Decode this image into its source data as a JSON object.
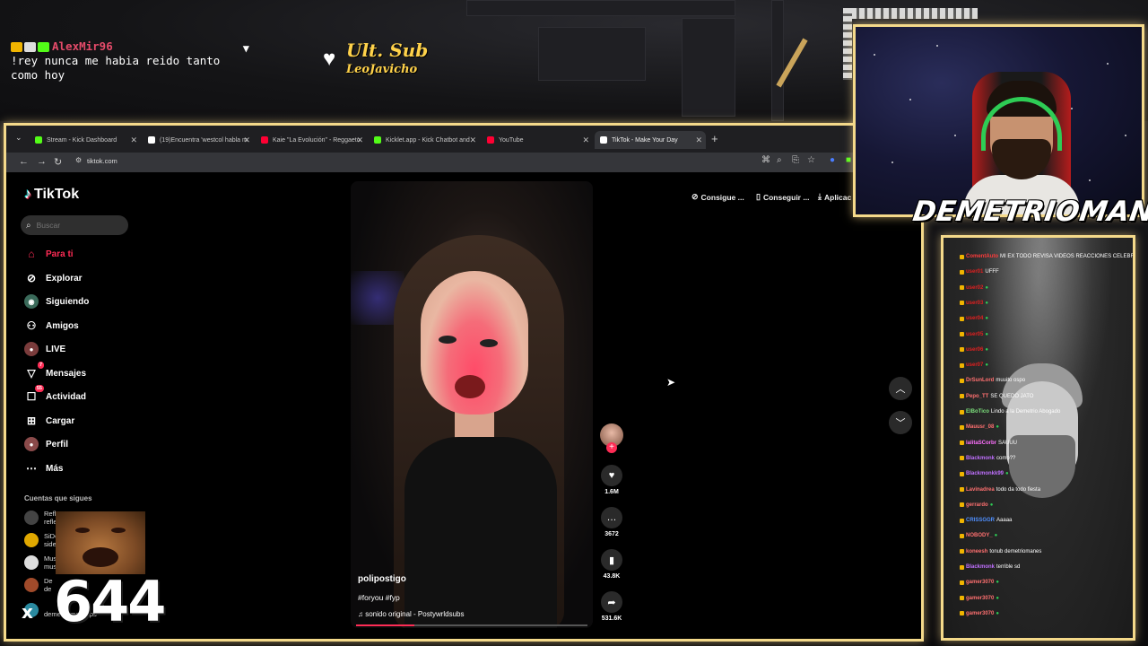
{
  "top_chat": {
    "username": "AlexMir96",
    "message": "!rey nunca me habia reido tanto como hoy"
  },
  "ult_sub": {
    "label": "Ult. Sub",
    "name": "LeoJavicho"
  },
  "browser": {
    "tabs": [
      {
        "label": "Stream - Kick Dashboard",
        "color": "#53fc18"
      },
      {
        "label": "(19)Encuentra 'westcol habla m",
        "color": "#ffffff"
      },
      {
        "label": "Kaie \"La Evolución\" - Reggaeto",
        "color": "#ff0033"
      },
      {
        "label": "Kicklet.app - Kick Chatbot and",
        "color": "#53fc18"
      },
      {
        "label": "YouTube",
        "color": "#ff0033"
      },
      {
        "label": "TikTok - Make Your Day",
        "color": "#ffffff"
      }
    ],
    "url": "tiktok.com"
  },
  "tiktok": {
    "logo": "TikTok",
    "search_placeholder": "Buscar",
    "nav": [
      {
        "label": "Para ti",
        "icon": "home-icon",
        "active": true
      },
      {
        "label": "Explorar",
        "icon": "compass-icon"
      },
      {
        "label": "Siguiendo",
        "icon": "following-icon"
      },
      {
        "label": "Amigos",
        "icon": "friends-icon"
      },
      {
        "label": "LIVE",
        "icon": "live-icon"
      },
      {
        "label": "Mensajes",
        "icon": "messages-icon",
        "badge": "7"
      },
      {
        "label": "Actividad",
        "icon": "activity-icon",
        "badge": "55"
      },
      {
        "label": "Cargar",
        "icon": "upload-icon"
      },
      {
        "label": "Perfil",
        "icon": "profile-icon"
      },
      {
        "label": "Más",
        "icon": "more-icon"
      }
    ],
    "following_title": "Cuentas que sigues",
    "following": [
      {
        "line1": "Refl",
        "line2": "refle"
      },
      {
        "line1": "SiDe",
        "line2": "side"
      },
      {
        "line1": "Mus",
        "line2": "mus"
      },
      {
        "line1": "De",
        "line2": "de"
      },
      {
        "line1": "Cli...",
        "line2": "demetriomanclips"
      }
    ],
    "top_actions": [
      "Consigue ...",
      "Conseguir ...",
      "Aplicac"
    ],
    "video": {
      "username": "polipostigo",
      "tags": "#foryou #fyp",
      "sound": "sonido original - Postywrldsubs",
      "progress": 0.25
    },
    "counts": {
      "likes": "1.6M",
      "comments": "3672",
      "saves": "43.8K",
      "shares": "531.6K"
    }
  },
  "overlay": {
    "combo_x": "x",
    "combo_count": "644",
    "streamer_name": "DEMETRIOMAN..."
  },
  "chat_overlay": {
    "lines": [
      {
        "user": "ComentAuto",
        "msg": "MI EX TODO REVISA VIDEOS REACCIONES CELEBRANDO O LA MANDARON NUEVOS VIDEOS PS",
        "color": "#ff3b3b"
      },
      {
        "user": "user01",
        "msg": "UFFF",
        "color": "#e02020"
      },
      {
        "user": "user02",
        "msg": "",
        "color": "#e02020"
      },
      {
        "user": "user03",
        "msg": "",
        "color": "#e02020"
      },
      {
        "user": "user04",
        "msg": "",
        "color": "#e02020"
      },
      {
        "user": "user05",
        "msg": "",
        "color": "#e02020"
      },
      {
        "user": "user06",
        "msg": "",
        "color": "#e02020"
      },
      {
        "user": "user07",
        "msg": "",
        "color": "#e02020"
      },
      {
        "user": "DrSunLord",
        "msg": "muuito ospo",
        "color": "#ff7070"
      },
      {
        "user": "Pepo_TT",
        "msg": "SE QUEDO JATO",
        "color": "#ff7070"
      },
      {
        "user": "ElBoTico",
        "msg": "Lindo a la Demetrio Abogado",
        "color": "#7ce07c"
      },
      {
        "user": "Mauusr_08",
        "msg": "",
        "color": "#ff7070"
      },
      {
        "user": "lalitaSCorbr",
        "msg": "SAUUU",
        "color": "#ff70ff"
      },
      {
        "user": "Blackmonk",
        "msg": "como??",
        "color": "#c070ff"
      },
      {
        "user": "Blackmonkk99",
        "msg": "",
        "color": "#c070ff"
      },
      {
        "user": "Lavinadrea",
        "msg": "todo da todo fiesta",
        "color": "#ff7070"
      },
      {
        "user": "gerrardo",
        "msg": "",
        "color": "#ff7070"
      },
      {
        "user": "CRISSGGR",
        "msg": "Aaaaa",
        "color": "#5090ff"
      },
      {
        "user": "NOBODY_",
        "msg": "",
        "color": "#ff7070"
      },
      {
        "user": "koneesh",
        "msg": "tonub demetriomanes",
        "color": "#ff7070"
      },
      {
        "user": "Blackmonk",
        "msg": "terrible sd",
        "color": "#c070ff"
      },
      {
        "user": "gamer3070",
        "msg": "",
        "color": "#ff7070"
      },
      {
        "user": "gamer3070",
        "msg": "",
        "color": "#ff7070"
      },
      {
        "user": "gamer3070",
        "msg": "",
        "color": "#ff7070"
      }
    ]
  }
}
